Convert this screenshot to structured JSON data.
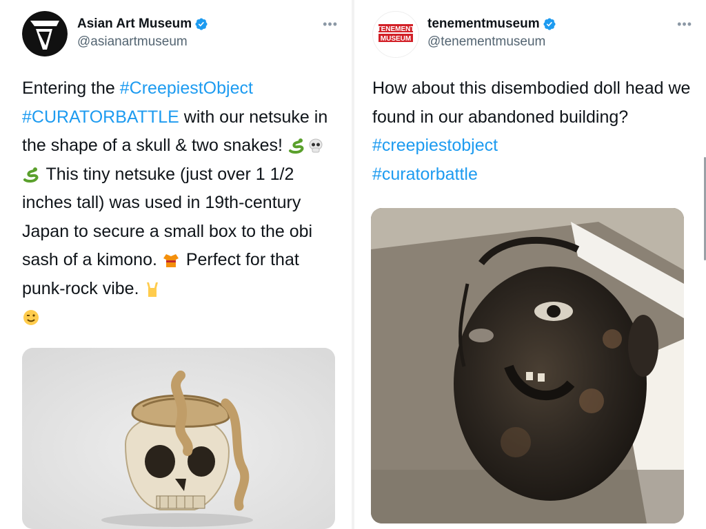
{
  "colors": {
    "link": "#1d9bf0",
    "text": "#0f1419",
    "secondary": "#536471",
    "verified": "#1d9bf0"
  },
  "left_tweet": {
    "display_name": "Asian Art Museum",
    "handle": "@asianartmuseum",
    "verified": true,
    "more_icon": "more-horizontal-icon",
    "text_parts": {
      "p1": "Entering the ",
      "tag1": "#CreepiestObject",
      "tag2": "#CURATORBATTLE",
      "p2": " with our netsuke in the shape of a skull & two snakes! ",
      "p3": " This tiny netsuke (just over 1 1/2 inches tall) was used in 19th-century Japan to secure a small box to the obi sash of a kimono. ",
      "p4": " Perfect for that punk-rock vibe. "
    },
    "emojis": [
      "snake-emoji",
      "skull-emoji",
      "snake-emoji",
      "kimono-emoji",
      "sign-of-horns-emoji",
      "winking-face-emoji"
    ],
    "media": "netsuke-skull-with-snakes-photo"
  },
  "right_tweet": {
    "display_name": "tenementmuseum",
    "handle": "@tenementmuseum",
    "verified": true,
    "avatar_text_top": "TENEMENT",
    "avatar_text_bottom": "MUSEUM",
    "more_icon": "more-horizontal-icon",
    "text_parts": {
      "p1": "How about this disembodied doll head we found in our abandoned building? ",
      "tag1": "#creepiestobject",
      "tag2": "#curatorbattle"
    },
    "media": "disembodied-doll-head-photo"
  }
}
